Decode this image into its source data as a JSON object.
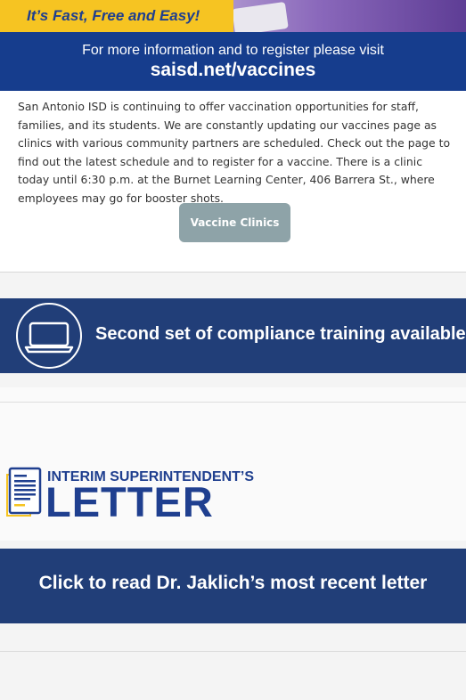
{
  "hero": {
    "tagline": "It’s Fast, Free and Easy!",
    "info_line": "For more information and to register please visit",
    "info_url": "saisd.net/vaccines"
  },
  "article": {
    "body": "San Antonio ISD is continuing to offer vaccination opportunities for staff, families, and its students. We are constantly updating our vaccines page as clinics with various community partners are scheduled. Check out the page to find out the latest schedule and to register for a vaccine. There is a clinic today until 6:30 p.m. at the Burnet Learning Center, 406 Barrera St., where employees may go for booster shots.",
    "button_label": "Vaccine Clinics"
  },
  "compliance": {
    "title": "Second set of compliance training available",
    "icon": "laptop-icon"
  },
  "letter": {
    "header_top": "INTERIM SUPERINTENDENT’S",
    "header_big": "LETTER",
    "icon": "document-icon",
    "banner_text": "Click to read Dr. Jaklich’s most recent letter"
  },
  "colors": {
    "navy": "#213e78",
    "royal_blue": "#163d8d",
    "gold": "#f6c422",
    "button_gray": "#8ea3a8",
    "text_blue": "#1f3f8f"
  }
}
